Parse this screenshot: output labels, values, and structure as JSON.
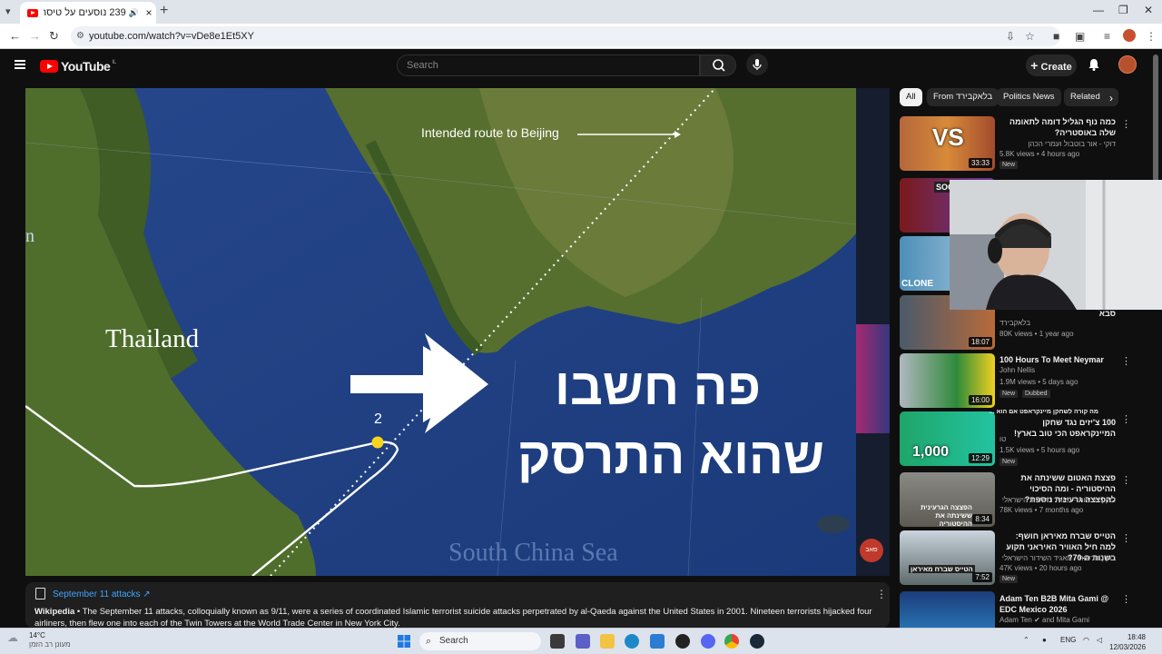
{
  "browser": {
    "tab_title": "239 נוסעים על טיסה זו...",
    "url": "youtube.com/watch?v=vDe8e1Et5XY"
  },
  "youtube": {
    "logo_text": "YouTube",
    "country_code": "IL",
    "search_placeholder": "Search",
    "create_label": "Create"
  },
  "video": {
    "map_label_route": "Intended route to Beijing",
    "map_label_thailand": "Thailand",
    "map_label_sea": "South China Sea",
    "waypoint_label": "2",
    "caption_line1": "פה חשבו",
    "caption_line2": "שהוא התרסק",
    "watermark": "סאב",
    "edge_letter": "n"
  },
  "description": {
    "title": "September 11 attacks ↗",
    "source": "Wikipedia",
    "text": " • The September 11 attacks, colloquially known as 9/11, were a series of coordinated Islamic terrorist suicide attacks perpetrated by al-Qaeda against the United States in 2001. Nineteen terrorists hijacked four airliners, then flew one into each of the Twin Towers at the World Trade Center in New York City."
  },
  "chips": [
    "All",
    "From בלאקבירד",
    "Politics News",
    "Related"
  ],
  "recommendations": [
    {
      "title": "כמה נוף הגליל דומה לתאומה שלה באוסטריה?",
      "channel": "דוקי - אור בוטבול ועמרי הכהן",
      "meta": "5.8K views • 4 hours ago",
      "badge": "New",
      "duration": "33:33",
      "thumb_text": "VS",
      "rtl": true
    },
    {
      "title": "",
      "channel": "",
      "meta": "",
      "badge": "",
      "duration": "",
      "thumb_text": "SOCB",
      "rtl": true
    },
    {
      "title": "",
      "channel": "",
      "meta": "",
      "badge": "",
      "duration": "",
      "thumb_text": "CLONE",
      "rtl": true
    },
    {
      "title": "סבא",
      "channel": "בלאקבירד",
      "meta": "80K views • 1 year ago",
      "badge": "",
      "duration": "18:07",
      "thumb_text": "",
      "rtl": true
    },
    {
      "title": "100 Hours To Meet Neymar",
      "channel": "John Nellis",
      "meta": "1.9M views • 5 days ago",
      "badge": "New",
      "badge2": "Dubbed",
      "duration": "16:00",
      "thumb_text": "",
      "rtl": false
    },
    {
      "title": "100 צ'יזים נגד שחקן המיינקראפט הכי טוב בארץ!",
      "channel": "טו",
      "meta": "1.5K views • 5 hours ago",
      "badge": "New",
      "duration": "12:29",
      "thumb_text": "1,000",
      "thumb_text2": "מה קורה לשחקן מיינקראפט אם הוא ...",
      "rtl": true
    },
    {
      "title": "פצצת האטום ששינתה את ההיסטוריה - ומה הסיכוי להפצצה גרעינית נוספת?",
      "channel": "כאן | חדשות - תאגיד השידור הישראלי",
      "meta": "78K views • 7 months ago",
      "badge": "",
      "duration": "8:34",
      "thumb_text": "הפצצה הגרעינית ששינתה את ההיסטוריה",
      "rtl": true
    },
    {
      "title": "הטייס שברח מאיראן חושף: למה חיל האוויר האיראני תקוע בשנות ה-70?",
      "channel": "כאן | חדשות - תאגיד השידור הישראלי",
      "meta": "47K views • 20 hours ago",
      "badge": "New",
      "duration": "7:52",
      "thumb_text": "הטייס שברח מאיראן",
      "rtl": true
    },
    {
      "title": "Adam Ten B2B Mita Gami @ EDC Mexico 2026",
      "channel": "Adam Ten ✔ and Mita Gami",
      "meta": "",
      "badge": "",
      "duration": "",
      "thumb_text": "",
      "rtl": false
    }
  ],
  "taskbar": {
    "temp": "14°C",
    "weather_desc": "מעונן רב הזמן",
    "search_label": "Search",
    "lang": "ENG",
    "time": "18:48",
    "date": "12/03/2026"
  }
}
